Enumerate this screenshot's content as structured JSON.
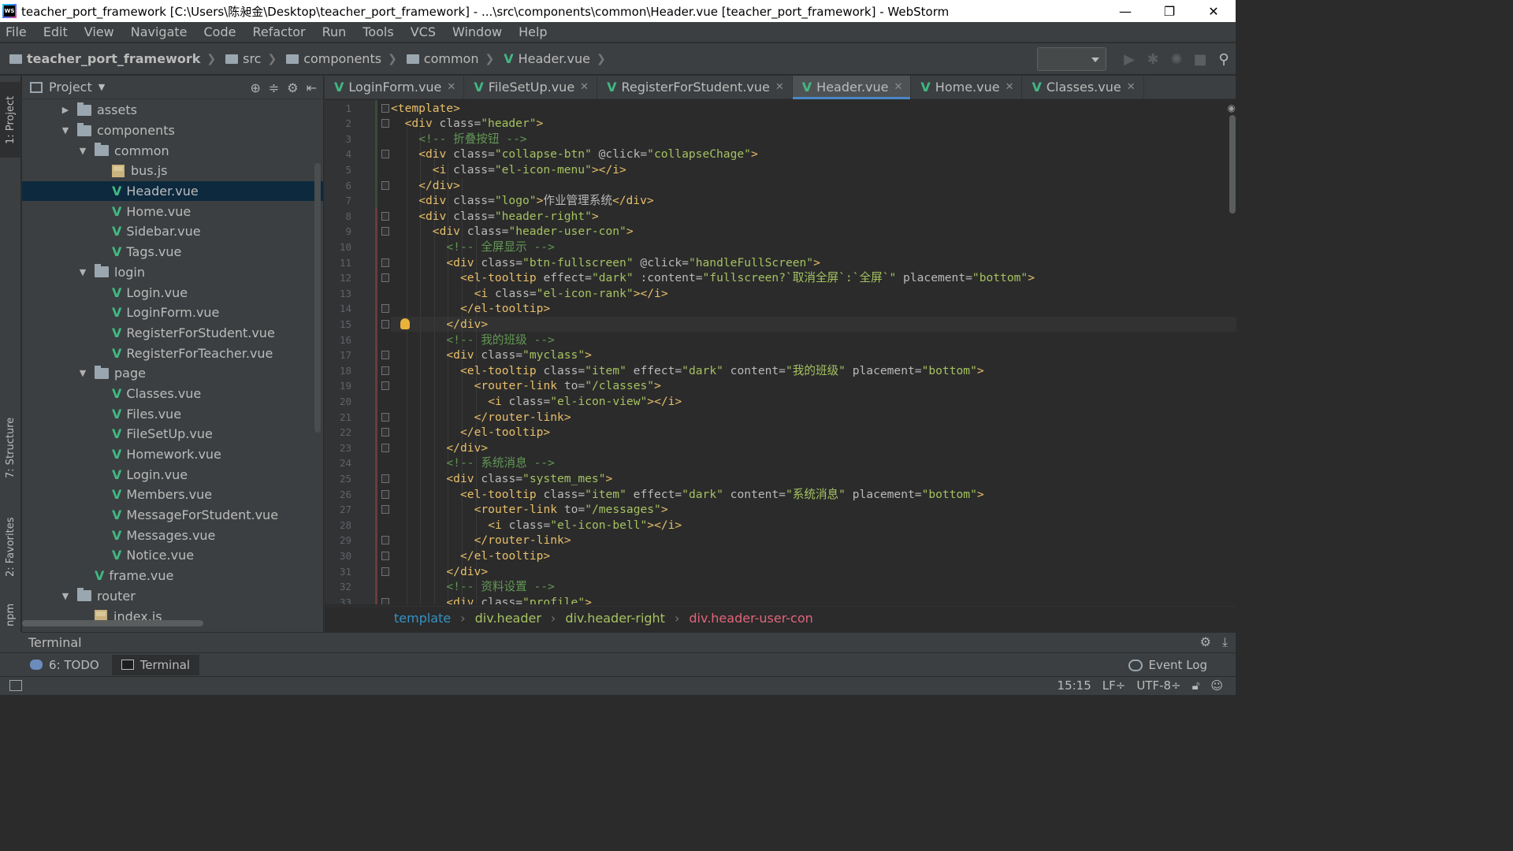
{
  "window": {
    "title": "teacher_port_framework [C:\\Users\\陈昶金\\Desktop\\teacher_port_framework] - ...\\src\\components\\common\\Header.vue [teacher_port_framework] - WebStorm",
    "minimize": "—",
    "restore": "❐",
    "close": "✕"
  },
  "menu": [
    "File",
    "Edit",
    "View",
    "Navigate",
    "Code",
    "Refactor",
    "Run",
    "Tools",
    "VCS",
    "Window",
    "Help"
  ],
  "breadcrumb": [
    "teacher_port_framework",
    "src",
    "components",
    "common",
    "Header.vue"
  ],
  "side_tabs": {
    "project": "1: Project",
    "structure": "7: Structure",
    "favorites": "2: Favorites",
    "npm": "npm"
  },
  "project_panel": {
    "title": "Project",
    "tree": [
      {
        "label": "assets",
        "type": "folder",
        "depth": 2,
        "expanded": false
      },
      {
        "label": "components",
        "type": "folder",
        "depth": 2,
        "expanded": true
      },
      {
        "label": "common",
        "type": "folder",
        "depth": 3,
        "expanded": true
      },
      {
        "label": "bus.js",
        "type": "js",
        "depth": 4
      },
      {
        "label": "Header.vue",
        "type": "vue",
        "depth": 4,
        "selected": true
      },
      {
        "label": "Home.vue",
        "type": "vue",
        "depth": 4
      },
      {
        "label": "Sidebar.vue",
        "type": "vue",
        "depth": 4
      },
      {
        "label": "Tags.vue",
        "type": "vue",
        "depth": 4
      },
      {
        "label": "login",
        "type": "folder",
        "depth": 3,
        "expanded": true
      },
      {
        "label": "Login.vue",
        "type": "vue",
        "depth": 4
      },
      {
        "label": "LoginForm.vue",
        "type": "vue",
        "depth": 4
      },
      {
        "label": "RegisterForStudent.vue",
        "type": "vue",
        "depth": 4
      },
      {
        "label": "RegisterForTeacher.vue",
        "type": "vue",
        "depth": 4
      },
      {
        "label": "page",
        "type": "folder",
        "depth": 3,
        "expanded": true
      },
      {
        "label": "Classes.vue",
        "type": "vue",
        "depth": 4
      },
      {
        "label": "Files.vue",
        "type": "vue",
        "depth": 4
      },
      {
        "label": "FileSetUp.vue",
        "type": "vue",
        "depth": 4
      },
      {
        "label": "Homework.vue",
        "type": "vue",
        "depth": 4
      },
      {
        "label": "Login.vue",
        "type": "vue",
        "depth": 4
      },
      {
        "label": "Members.vue",
        "type": "vue",
        "depth": 4
      },
      {
        "label": "MessageForStudent.vue",
        "type": "vue",
        "depth": 4
      },
      {
        "label": "Messages.vue",
        "type": "vue",
        "depth": 4
      },
      {
        "label": "Notice.vue",
        "type": "vue",
        "depth": 4
      },
      {
        "label": "frame.vue",
        "type": "vue",
        "depth": 3
      },
      {
        "label": "router",
        "type": "folder",
        "depth": 2,
        "expanded": true
      },
      {
        "label": "index.js",
        "type": "js",
        "depth": 3
      }
    ]
  },
  "editor_tabs": [
    {
      "label": "LoginForm.vue",
      "active": false
    },
    {
      "label": "FileSetUp.vue",
      "active": false
    },
    {
      "label": "RegisterForStudent.vue",
      "active": false
    },
    {
      "label": "Header.vue",
      "active": true
    },
    {
      "label": "Home.vue",
      "active": false
    },
    {
      "label": "Classes.vue",
      "active": false
    }
  ],
  "code_lines": [
    {
      "n": "1",
      "indent": 0,
      "parts": [
        [
          "tag",
          "<template>"
        ]
      ]
    },
    {
      "n": "2",
      "indent": 1,
      "parts": [
        [
          "tag",
          "<div "
        ],
        [
          "attr",
          "class="
        ],
        [
          "val",
          "\"header\""
        ],
        [
          "tag",
          ">"
        ]
      ]
    },
    {
      "n": "3",
      "indent": 2,
      "parts": [
        [
          "cmt",
          "<!-- 折叠按钮 -->"
        ]
      ]
    },
    {
      "n": "4",
      "indent": 2,
      "parts": [
        [
          "tag",
          "<div "
        ],
        [
          "attr",
          "class="
        ],
        [
          "val",
          "\"collapse-btn\""
        ],
        [
          "attr",
          " @click="
        ],
        [
          "val",
          "\"collapseChage\""
        ],
        [
          "tag",
          ">"
        ]
      ]
    },
    {
      "n": "5",
      "indent": 3,
      "parts": [
        [
          "tag",
          "<i "
        ],
        [
          "attr",
          "class="
        ],
        [
          "val",
          "\"el-icon-menu\""
        ],
        [
          "tag",
          "></i>"
        ]
      ]
    },
    {
      "n": "6",
      "indent": 2,
      "parts": [
        [
          "tag",
          "</div>"
        ]
      ]
    },
    {
      "n": "7",
      "indent": 2,
      "parts": [
        [
          "tag",
          "<div "
        ],
        [
          "attr",
          "class="
        ],
        [
          "val",
          "\"logo\""
        ],
        [
          "tag",
          ">"
        ],
        [
          "attr",
          "作业管理系统"
        ],
        [
          "tag",
          "</div>"
        ]
      ]
    },
    {
      "n": "8",
      "indent": 2,
      "parts": [
        [
          "tag",
          "<div "
        ],
        [
          "attr",
          "class="
        ],
        [
          "val",
          "\"header-right\""
        ],
        [
          "tag",
          ">"
        ]
      ]
    },
    {
      "n": "9",
      "indent": 3,
      "parts": [
        [
          "tag",
          "<div "
        ],
        [
          "attr",
          "class="
        ],
        [
          "val",
          "\"header-user-con\""
        ],
        [
          "tag",
          ">"
        ]
      ]
    },
    {
      "n": "10",
      "indent": 4,
      "parts": [
        [
          "cmt",
          "<!-- 全屏显示 -->"
        ]
      ]
    },
    {
      "n": "11",
      "indent": 4,
      "parts": [
        [
          "tag",
          "<div "
        ],
        [
          "attr",
          "class="
        ],
        [
          "val",
          "\"btn-fullscreen\""
        ],
        [
          "attr",
          " @click="
        ],
        [
          "val",
          "\"handleFullScreen\""
        ],
        [
          "tag",
          ">"
        ]
      ]
    },
    {
      "n": "12",
      "indent": 5,
      "parts": [
        [
          "tag",
          "<el-tooltip "
        ],
        [
          "attr",
          "effect="
        ],
        [
          "val",
          "\"dark\""
        ],
        [
          "attr",
          " :content="
        ],
        [
          "val",
          "\"fullscreen?`取消全屏`:`全屏`\""
        ],
        [
          "attr",
          " placement="
        ],
        [
          "val",
          "\"bottom\""
        ],
        [
          "tag",
          ">"
        ]
      ]
    },
    {
      "n": "13",
      "indent": 6,
      "parts": [
        [
          "tag",
          "<i "
        ],
        [
          "attr",
          "class="
        ],
        [
          "val",
          "\"el-icon-rank\""
        ],
        [
          "tag",
          "></i>"
        ]
      ]
    },
    {
      "n": "14",
      "indent": 5,
      "parts": [
        [
          "tag",
          "</el-tooltip>"
        ]
      ]
    },
    {
      "n": "15",
      "indent": 4,
      "parts": [
        [
          "tag",
          "</div>"
        ]
      ]
    },
    {
      "n": "16",
      "indent": 4,
      "parts": [
        [
          "cmt",
          "<!-- 我的班级 -->"
        ]
      ]
    },
    {
      "n": "17",
      "indent": 4,
      "parts": [
        [
          "tag",
          "<div "
        ],
        [
          "attr",
          "class="
        ],
        [
          "val",
          "\"myclass\""
        ],
        [
          "tag",
          ">"
        ]
      ]
    },
    {
      "n": "18",
      "indent": 5,
      "parts": [
        [
          "tag",
          "<el-tooltip "
        ],
        [
          "attr",
          "class="
        ],
        [
          "val",
          "\"item\""
        ],
        [
          "attr",
          " effect="
        ],
        [
          "val",
          "\"dark\""
        ],
        [
          "attr",
          " content="
        ],
        [
          "val",
          "\"我的班级\""
        ],
        [
          "attr",
          " placement="
        ],
        [
          "val",
          "\"bottom\""
        ],
        [
          "tag",
          ">"
        ]
      ]
    },
    {
      "n": "19",
      "indent": 6,
      "parts": [
        [
          "tag",
          "<router-link "
        ],
        [
          "attr",
          "to="
        ],
        [
          "val",
          "\"/classes\""
        ],
        [
          "tag",
          ">"
        ]
      ]
    },
    {
      "n": "20",
      "indent": 7,
      "parts": [
        [
          "tag",
          "<i "
        ],
        [
          "attr",
          "class="
        ],
        [
          "val",
          "\"el-icon-view\""
        ],
        [
          "tag",
          "></i>"
        ]
      ]
    },
    {
      "n": "21",
      "indent": 6,
      "parts": [
        [
          "tag",
          "</router-link>"
        ]
      ]
    },
    {
      "n": "22",
      "indent": 5,
      "parts": [
        [
          "tag",
          "</el-tooltip>"
        ]
      ]
    },
    {
      "n": "23",
      "indent": 4,
      "parts": [
        [
          "tag",
          "</div>"
        ]
      ]
    },
    {
      "n": "24",
      "indent": 4,
      "parts": [
        [
          "cmt",
          "<!-- 系统消息 -->"
        ]
      ]
    },
    {
      "n": "25",
      "indent": 4,
      "parts": [
        [
          "tag",
          "<div "
        ],
        [
          "attr",
          "class="
        ],
        [
          "val",
          "\"system_mes\""
        ],
        [
          "tag",
          ">"
        ]
      ]
    },
    {
      "n": "26",
      "indent": 5,
      "parts": [
        [
          "tag",
          "<el-tooltip "
        ],
        [
          "attr",
          "class="
        ],
        [
          "val",
          "\"item\""
        ],
        [
          "attr",
          " effect="
        ],
        [
          "val",
          "\"dark\""
        ],
        [
          "attr",
          " content="
        ],
        [
          "val",
          "\"系统消息\""
        ],
        [
          "attr",
          " placement="
        ],
        [
          "val",
          "\"bottom\""
        ],
        [
          "tag",
          ">"
        ]
      ]
    },
    {
      "n": "27",
      "indent": 6,
      "parts": [
        [
          "tag",
          "<router-link "
        ],
        [
          "attr",
          "to="
        ],
        [
          "val",
          "\"/messages\""
        ],
        [
          "tag",
          ">"
        ]
      ]
    },
    {
      "n": "28",
      "indent": 7,
      "parts": [
        [
          "tag",
          "<i "
        ],
        [
          "attr",
          "class="
        ],
        [
          "val",
          "\"el-icon-bell\""
        ],
        [
          "tag",
          "></i>"
        ]
      ]
    },
    {
      "n": "29",
      "indent": 6,
      "parts": [
        [
          "tag",
          "</router-link>"
        ]
      ]
    },
    {
      "n": "30",
      "indent": 5,
      "parts": [
        [
          "tag",
          "</el-tooltip>"
        ]
      ]
    },
    {
      "n": "31",
      "indent": 4,
      "parts": [
        [
          "tag",
          "</div>"
        ]
      ]
    },
    {
      "n": "32",
      "indent": 4,
      "parts": [
        [
          "cmt",
          "<!-- 资料设置 -->"
        ]
      ]
    },
    {
      "n": "33",
      "indent": 4,
      "parts": [
        [
          "tag",
          "<div "
        ],
        [
          "attr",
          "class="
        ],
        [
          "val",
          "\"profile\""
        ],
        [
          "tag",
          ">"
        ]
      ]
    }
  ],
  "editor_breadcrumb": [
    "template",
    "div.header",
    "div.header-right",
    "div.header-user-con"
  ],
  "terminal": {
    "title": "Terminal"
  },
  "bottom_tabs": {
    "todo": "6: TODO",
    "terminal": "Terminal",
    "event_log": "Event Log"
  },
  "status": {
    "position": "15:15",
    "line_sep": "LF÷",
    "encoding": "UTF-8÷"
  },
  "colors": {
    "accent": "#4a88c7",
    "vue_green": "#41b883",
    "tag": "#e8bf6a",
    "value": "#a5c261",
    "comment": "#629755"
  }
}
